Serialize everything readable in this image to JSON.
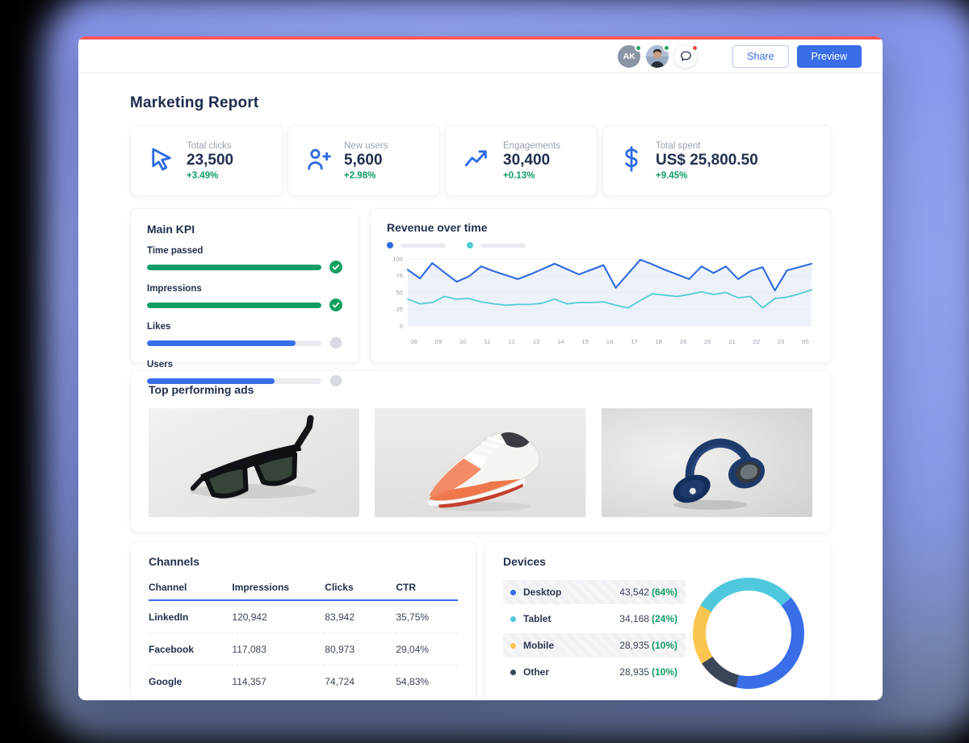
{
  "header": {
    "avatars": [
      {
        "initials": "AK",
        "bg": "#8a94a4",
        "status_color": "#27a567"
      },
      {
        "initials": "",
        "bg": "#aebdd3",
        "status_color": "#27a567",
        "type": "photo"
      }
    ],
    "chat_status_color": "#e8483f",
    "share_label": "Share",
    "preview_label": "Preview"
  },
  "page_title": "Marketing Report",
  "accent_bar_color": "#fa5a5d",
  "stats": [
    {
      "icon": "cursor-icon",
      "label": "Total clicks",
      "value": "23,500",
      "delta": "+3.49%"
    },
    {
      "icon": "user-plus-icon",
      "label": "New users",
      "value": "5,600",
      "delta": "+2.98%"
    },
    {
      "icon": "trending-up-icon",
      "label": "Engagements",
      "value": "30,400",
      "delta": "+0.13%"
    },
    {
      "icon": "dollar-icon",
      "label": "Total spent",
      "value": "US$ 25,800.50",
      "delta": "+9.45%"
    }
  ],
  "main_kpi": {
    "title": "Main KPI",
    "items": [
      {
        "label": "Time passed",
        "progress": 100,
        "complete": true,
        "bar_color": "#0c9e66"
      },
      {
        "label": "Impressions",
        "progress": 100,
        "complete": true,
        "bar_color": "#0c9e66"
      },
      {
        "label": "Likes",
        "progress": 85,
        "complete": false,
        "bar_color": "#3a6ee8"
      },
      {
        "label": "Users",
        "progress": 73,
        "complete": false,
        "bar_color": "#3a6ee8"
      }
    ],
    "check_color": "#12a062",
    "pending_color": "#d8dbe2"
  },
  "chart_data": {
    "type": "line",
    "title": "Revenue over time",
    "x_labels": [
      "08",
      "09",
      "10",
      "11",
      "12",
      "13",
      "14",
      "15",
      "16",
      "17",
      "18",
      "19",
      "20",
      "21",
      "22",
      "23",
      "00"
    ],
    "y_ticks": [
      0,
      25,
      50,
      75,
      100
    ],
    "ylim": [
      0,
      100
    ],
    "grid": true,
    "legend_position": "top-left",
    "legend_style": "placeholder-pills",
    "series": [
      {
        "name": "series-1",
        "color": "#2f6ae0",
        "fill": "rgba(228,233,246,0.65)",
        "values": [
          84,
          71,
          94,
          80,
          66,
          74,
          89,
          82,
          76,
          70,
          77,
          85,
          93,
          85,
          77,
          84,
          91,
          57,
          78,
          99,
          92,
          84,
          77,
          70,
          89,
          79,
          89,
          70,
          82,
          88,
          53,
          83,
          88,
          93
        ]
      },
      {
        "name": "series-2",
        "color": "#55cbd6",
        "fill": null,
        "values": [
          40,
          33,
          35,
          44,
          40,
          41,
          36,
          33,
          31,
          32,
          32,
          34,
          40,
          33,
          35,
          35,
          36,
          31,
          27,
          38,
          48,
          46,
          44,
          47,
          51,
          47,
          50,
          42,
          44,
          27,
          41,
          43,
          48,
          54
        ]
      }
    ]
  },
  "top_ads": {
    "title": "Top performing ads",
    "items": [
      {
        "name": "sunglasses-image"
      },
      {
        "name": "sneaker-image"
      },
      {
        "name": "headphones-image"
      }
    ]
  },
  "channels": {
    "title": "Channels",
    "columns": [
      "Channel",
      "Impressions",
      "Clicks",
      "CTR"
    ],
    "rows": [
      [
        "LinkedIn",
        "120,942",
        "83,942",
        "35,75%"
      ],
      [
        "Facebook",
        "117,083",
        "80,973",
        "29,04%"
      ],
      [
        "Google",
        "114,357",
        "74,724",
        "54,83%"
      ]
    ]
  },
  "devices": {
    "title": "Devices",
    "items": [
      {
        "label": "Desktop",
        "value": "43,542",
        "percent": "(64%)",
        "color": "#3a6ee8",
        "hatched": true
      },
      {
        "label": "Tablet",
        "value": "34,168",
        "percent": "(24%)",
        "color": "#4fc8dd",
        "hatched": false
      },
      {
        "label": "Mobile",
        "value": "28,935",
        "percent": "(10%)",
        "color": "#fbc64f",
        "hatched": true
      },
      {
        "label": "Other",
        "value": "28,935",
        "percent": "(10%)",
        "color": "#3a4557",
        "hatched": false
      }
    ],
    "donut": {
      "from_deg": 50,
      "segments": [
        {
          "name": "desktop",
          "color": "#3a6ee8",
          "sweep_deg": 143
        },
        {
          "name": "other",
          "color": "#3a4557",
          "sweep_deg": 44
        },
        {
          "name": "mobile",
          "color": "#fbc64f",
          "sweep_deg": 63
        },
        {
          "name": "tablet",
          "color": "#4fc8dd",
          "sweep_deg": 110
        }
      ]
    }
  }
}
